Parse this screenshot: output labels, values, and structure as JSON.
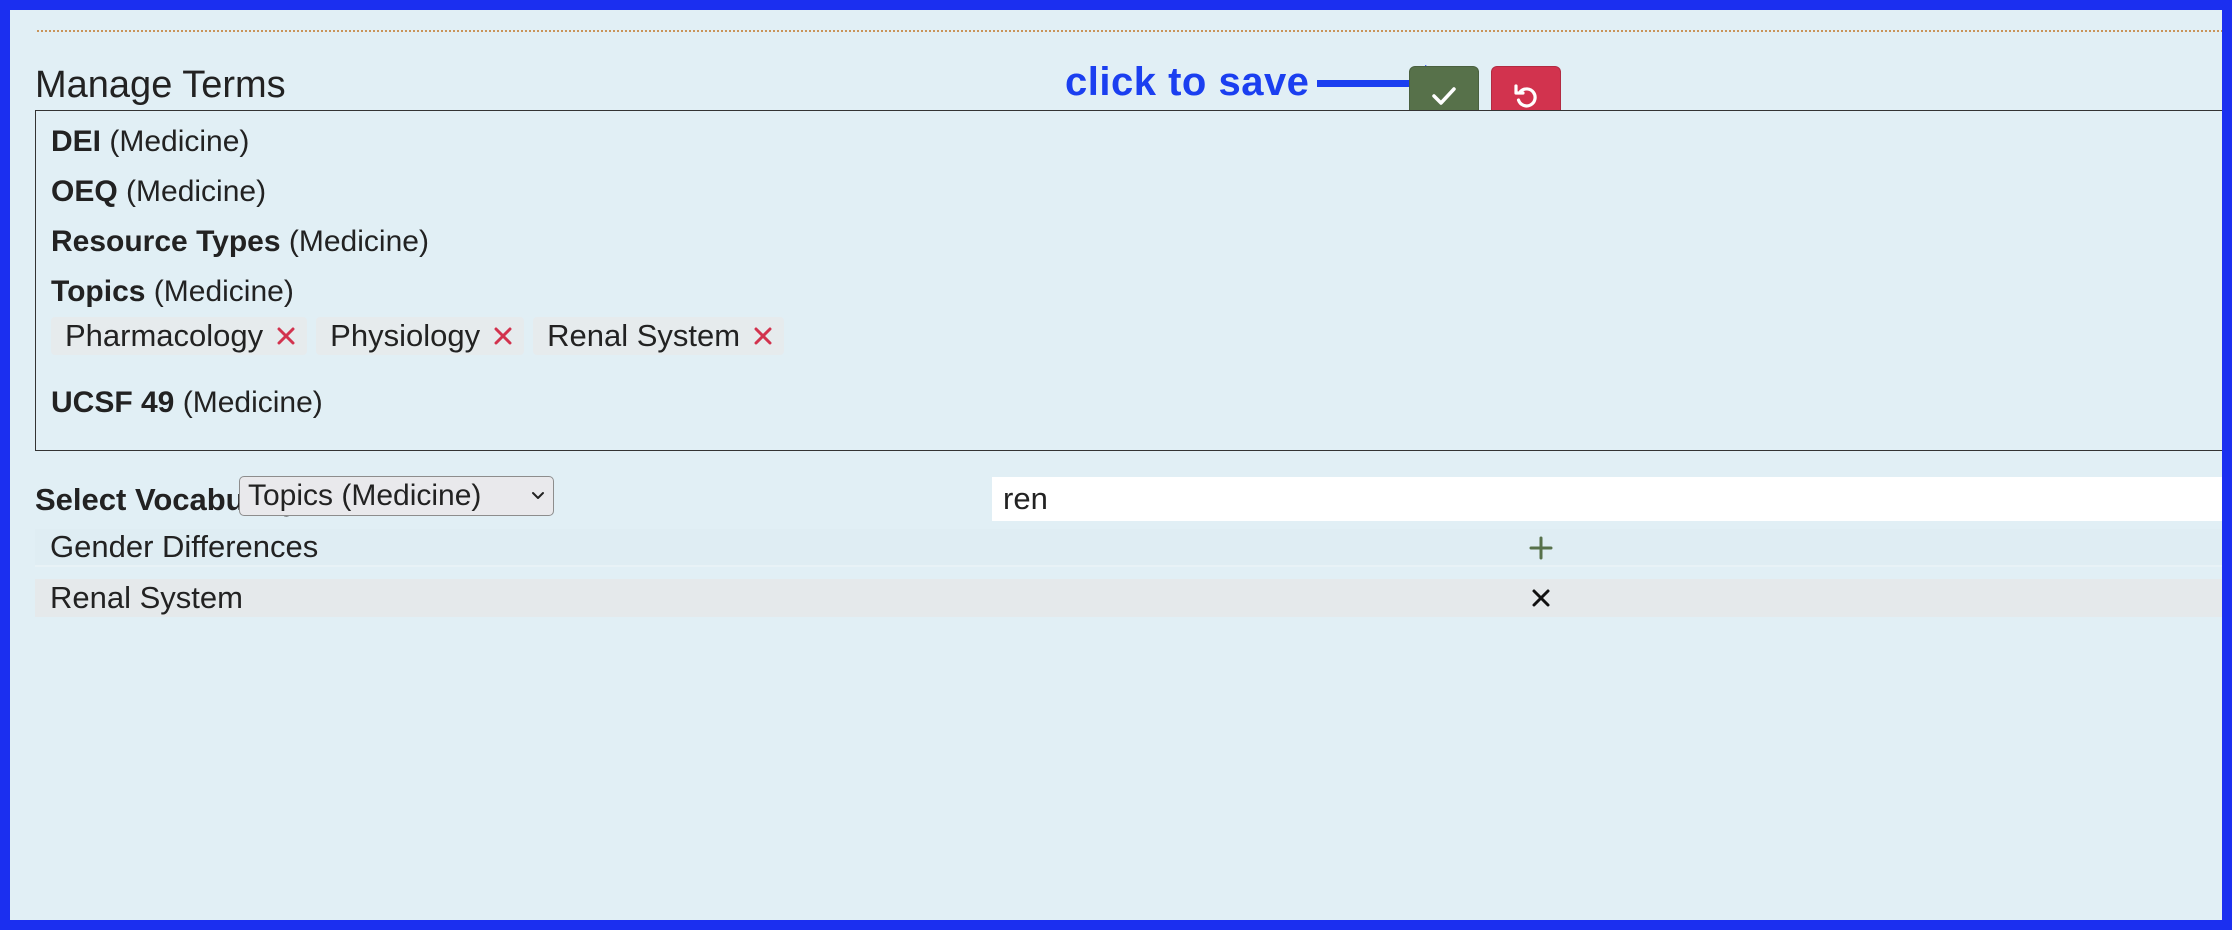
{
  "header": {
    "title": "Manage Terms",
    "annotation": "click to save"
  },
  "actions": {
    "save_icon": "check-icon",
    "revert_icon": "undo-icon",
    "save_color": "#57714a",
    "revert_color": "#d2334e"
  },
  "vocabularies": [
    {
      "name": "DEI",
      "scope": "(Medicine)"
    },
    {
      "name": "OEQ",
      "scope": "(Medicine)"
    },
    {
      "name": "Resource Types",
      "scope": "(Medicine)"
    },
    {
      "name": "Topics",
      "scope": "(Medicine)"
    },
    {
      "name": "UCSF 49",
      "scope": "(Medicine)"
    }
  ],
  "selected_terms": [
    {
      "label": "Pharmacology"
    },
    {
      "label": "Physiology"
    },
    {
      "label": "Renal System"
    }
  ],
  "selector": {
    "label": "Select Vocabulary:",
    "selected": "Topics (Medicine)"
  },
  "search": {
    "value": "ren",
    "placeholder": ""
  },
  "results": [
    {
      "label": "Gender Differences",
      "action_icon": "plus-icon"
    },
    {
      "label": "Renal System",
      "action_icon": "close-icon"
    }
  ],
  "colors": {
    "frame_border": "#1b2ff0",
    "annotation": "#1b3ff0",
    "remove_x": "#d2334e",
    "add_plus": "#57714a"
  }
}
